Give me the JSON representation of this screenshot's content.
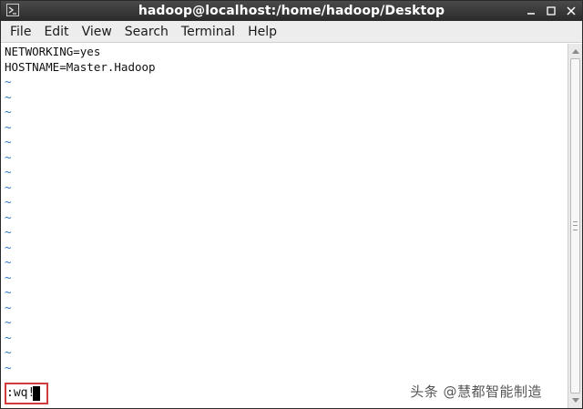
{
  "window": {
    "title": "hadoop@localhost:/home/hadoop/Desktop"
  },
  "menu": [
    {
      "label": "File"
    },
    {
      "label": "Edit"
    },
    {
      "label": "View"
    },
    {
      "label": "Search"
    },
    {
      "label": "Terminal"
    },
    {
      "label": "Help"
    }
  ],
  "terminal": {
    "lines": [
      "NETWORKING=yes",
      "HOSTNAME=Master.Hadoop"
    ],
    "tilde": "~",
    "command": ":wq!"
  },
  "watermark": "头条 @慧都智能制造",
  "colors": {
    "tilde": "#2a76c6",
    "highlight_box": "#d23b3b"
  },
  "icons": {
    "app": "terminal-icon",
    "minimize": "minimize-icon",
    "maximize": "maximize-icon",
    "close": "close-icon"
  }
}
